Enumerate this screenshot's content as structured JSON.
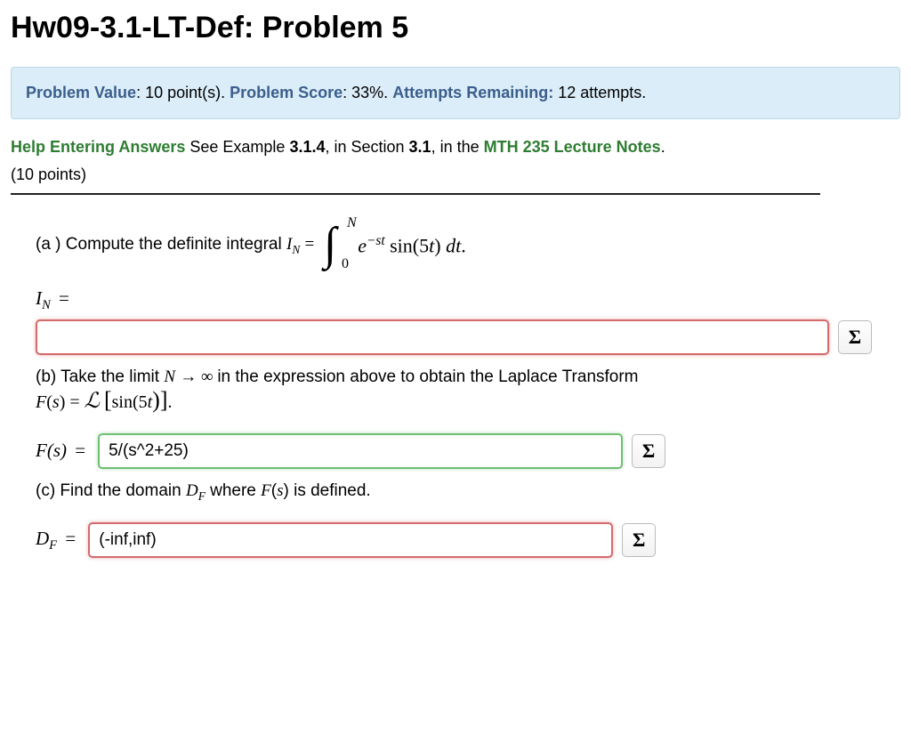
{
  "title": "Hw09-3.1-LT-Def: Problem 5",
  "info": {
    "value_label": "Problem Value",
    "value_text": ": 10 point(s). ",
    "score_label": "Problem Score",
    "score_text": ": 33%. ",
    "attempts_label": "Attempts Remaining:",
    "attempts_text": " 12 attempts."
  },
  "help": {
    "link": "Help Entering Answers",
    "see": "   See Example ",
    "ex": "3.1.4",
    "mid": ", in Section ",
    "sec": "3.1",
    "mid2": ", in the ",
    "notes": "MTH 235 Lecture Notes",
    "period": "."
  },
  "points_line": "(10 points)",
  "partA": {
    "text": "(a ) Compute the definite integral ",
    "IN": "I",
    "N": "N",
    "eq": " = ",
    "upper": "N",
    "lower": "0",
    "integrand_e": "e",
    "integrand_exp": "−st",
    "sin": " sin(5",
    "t": "t",
    "close": ") ",
    "dt_d": "d",
    "dt_t": "t",
    "dot": ".",
    "label_I": "I",
    "label_N": "N",
    "label_eq": " =",
    "value": ""
  },
  "partB": {
    "text1": "(b) Take the limit ",
    "Nvar": "N",
    "arrow": " → ∞ ",
    "text2": "in the expression above to obtain the Laplace Transform",
    "Fs": "F",
    "s_open": "(",
    "s": "s",
    "s_close": ") = ",
    "L": "ℒ",
    "br_open": "[",
    "sin5t": "sin(5",
    "t": "t",
    "br_close": ")]",
    "dot": ".",
    "label_F": "F",
    "label_s": "s",
    "label_eq": " = ",
    "value": "5/(s^2+25)"
  },
  "partC": {
    "text1": "(c) Find the domain ",
    "D": "D",
    "Fsub": "F",
    "text2": " where ",
    "Fs_F": "F",
    "Fs_s": "s",
    "text3": " is defined.",
    "label_D": "D",
    "label_F": "F",
    "label_eq": " = ",
    "value": "(-inf,inf)"
  },
  "sigma": "Σ"
}
